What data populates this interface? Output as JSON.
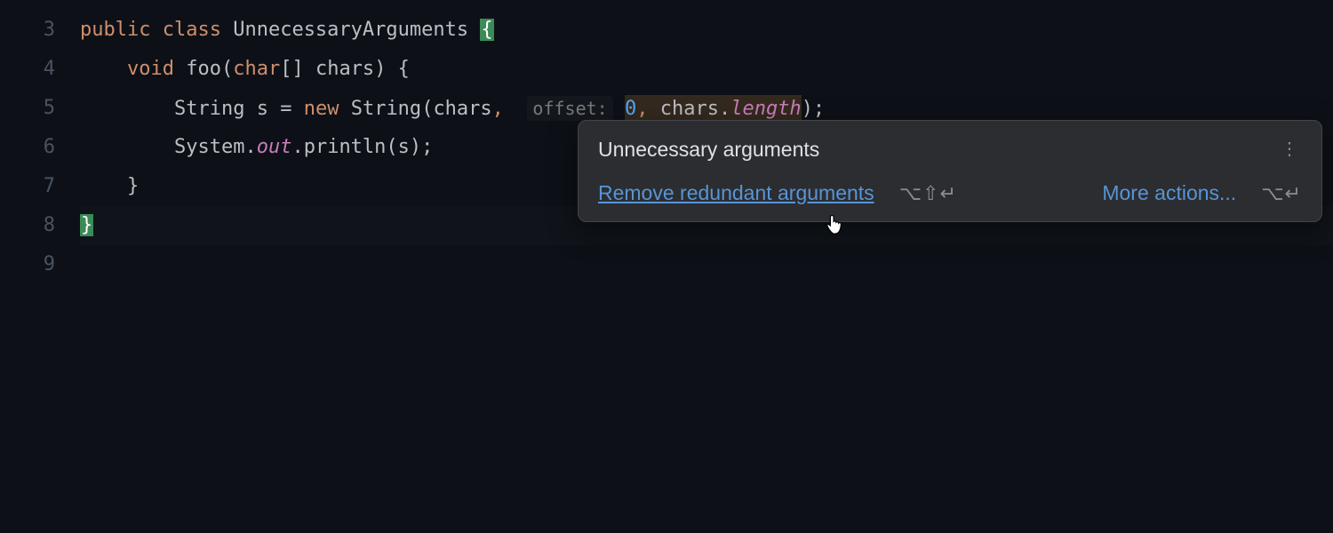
{
  "gutter": {
    "start": 3,
    "end": 9
  },
  "code": {
    "l3": {
      "kw_public": "public",
      "kw_class": "class",
      "class_name": "UnnecessaryArguments",
      "brace_open": "{"
    },
    "l4": {
      "kw_void": "void",
      "fn": "foo",
      "paren_open": "(",
      "kw_char": "char",
      "brackets": "[]",
      "param": "chars",
      "paren_close_brace": ") {"
    },
    "l5": {
      "type_string": "String",
      "var": "s",
      "eq": "=",
      "kw_new": "new",
      "ctor": "String",
      "paren_open": "(",
      "arg1": "chars",
      "comma1": ",",
      "hint_offset": "offset:",
      "zero": "0",
      "comma2": ",",
      "arg3a": "chars",
      "dot": ".",
      "arg3b": "length",
      "paren_close_semi": ");"
    },
    "l6": {
      "sys": "System",
      "dot1": ".",
      "out": "out",
      "dot2": ".",
      "println": "println",
      "args_s": "(s);"
    },
    "l7": {
      "brace_close": "}"
    },
    "l8": {
      "brace_close": "}"
    }
  },
  "popup": {
    "title": "Unnecessary arguments",
    "fix_label": "Remove redundant arguments",
    "fix_shortcut": "⌥⇧↵",
    "more_label": "More actions...",
    "more_shortcut": "⌥↵"
  }
}
